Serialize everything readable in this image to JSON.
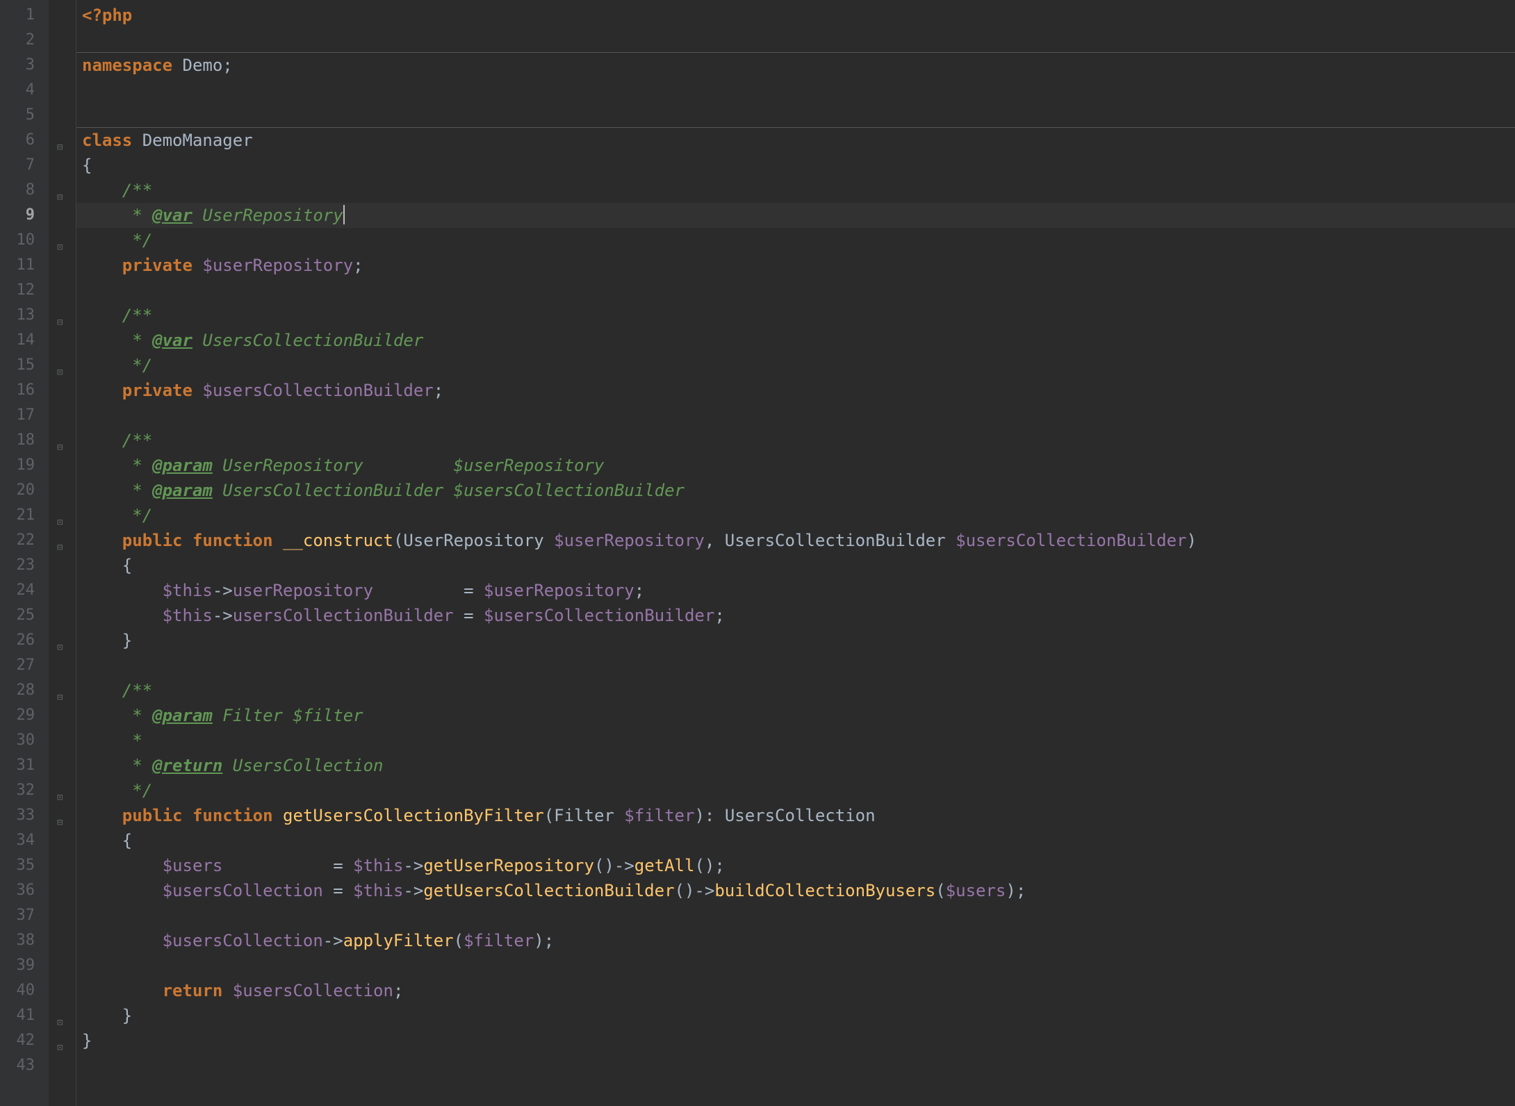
{
  "editor": {
    "current_line": 9,
    "line_numbers": [
      "1",
      "2",
      "3",
      "4",
      "5",
      "6",
      "7",
      "8",
      "9",
      "10",
      "11",
      "12",
      "13",
      "14",
      "15",
      "16",
      "17",
      "18",
      "19",
      "20",
      "21",
      "22",
      "23",
      "24",
      "25",
      "26",
      "27",
      "28",
      "29",
      "30",
      "31",
      "32",
      "33",
      "34",
      "35",
      "36",
      "37",
      "38",
      "39",
      "40",
      "41",
      "42",
      "43"
    ],
    "hr_after_lines": [
      2,
      5
    ],
    "fold_open_lines": [
      6,
      8,
      13,
      18,
      22,
      28,
      33
    ],
    "fold_close_lines": [
      10,
      15,
      21,
      26,
      32,
      41,
      42
    ],
    "tokens": {
      "l1": {
        "php_open": "<?php"
      },
      "l3": {
        "kw": "namespace",
        "name": " Demo",
        "semi": ";"
      },
      "l6": {
        "kw": "class",
        "name": " DemoManager"
      },
      "l7": {
        "brace": "{"
      },
      "l8": {
        "doc": "/**"
      },
      "l9": {
        "star": " * ",
        "tag": "@var",
        "type": " UserRepository"
      },
      "l10": {
        "doc": " */"
      },
      "l11": {
        "kw": "private",
        "var": " $userRepository",
        "semi": ";"
      },
      "l13": {
        "doc": "/**"
      },
      "l14": {
        "star": " * ",
        "tag": "@var",
        "type": " UsersCollectionBuilder"
      },
      "l15": {
        "doc": " */"
      },
      "l16": {
        "kw": "private",
        "var": " $usersCollectionBuilder",
        "semi": ";"
      },
      "l18": {
        "doc": "/**"
      },
      "l19": {
        "star": " * ",
        "tag": "@param",
        "type": " UserRepository         ",
        "pvar": "$userRepository"
      },
      "l20": {
        "star": " * ",
        "tag": "@param",
        "type": " UsersCollectionBuilder ",
        "pvar": "$usersCollectionBuilder"
      },
      "l21": {
        "doc": " */"
      },
      "l22": {
        "kw1": "public",
        "kw2": " function",
        "fn": " __construct",
        "p1": "(",
        "t1": "UserRepository ",
        "v1": "$userRepository",
        "c1": ", ",
        "t2": "UsersCollectionBuilder ",
        "v2": "$usersCollectionBuilder",
        "p2": ")"
      },
      "l23": {
        "brace": "{"
      },
      "l24": {
        "v1": "$this",
        "ar1": "->",
        "f1": "userRepository",
        "pad1": "         ",
        "eq": "= ",
        "v2": "$userRepository",
        "semi": ";"
      },
      "l25": {
        "v1": "$this",
        "ar1": "->",
        "f1": "usersCollectionBuilder",
        "pad1": " ",
        "eq": "= ",
        "v2": "$usersCollectionBuilder",
        "semi": ";"
      },
      "l26": {
        "brace": "}"
      },
      "l28": {
        "doc": "/**"
      },
      "l29": {
        "star": " * ",
        "tag": "@param",
        "type": " Filter ",
        "pvar": "$filter"
      },
      "l30": {
        "doc": " *"
      },
      "l31": {
        "star": " * ",
        "tag": "@return",
        "type": " UsersCollection"
      },
      "l32": {
        "doc": " */"
      },
      "l33": {
        "kw1": "public",
        "kw2": " function",
        "fn": " getUsersCollectionByFilter",
        "p1": "(",
        "t1": "Filter ",
        "v1": "$filter",
        "p2": ")",
        "colon": ": ",
        "rt": "UsersCollection"
      },
      "l34": {
        "brace": "{"
      },
      "l35": {
        "v1": "$users",
        "pad": "           ",
        "eq": "= ",
        "v2": "$this",
        "ar": "->",
        "f1": "getUserRepository",
        "c1": "()->",
        "f2": "getAll",
        "c2": "();"
      },
      "l36": {
        "v1": "$usersCollection",
        "pad": " ",
        "eq": "= ",
        "v2": "$this",
        "ar": "->",
        "f1": "getUsersCollectionBuilder",
        "c1": "()->",
        "f2": "buildCollectionByusers",
        "p1": "(",
        "v3": "$users",
        "p2": ");"
      },
      "l38": {
        "v1": "$usersCollection",
        "ar": "->",
        "f1": "applyFilter",
        "p1": "(",
        "v2": "$filter",
        "p2": ");"
      },
      "l40": {
        "kw": "return ",
        "v1": "$usersCollection",
        "semi": ";"
      },
      "l41": {
        "brace": "}"
      },
      "l42": {
        "brace": "}"
      }
    },
    "indents": {
      "i0": "",
      "i1": "    ",
      "i2": "        ",
      "i3": "            "
    }
  }
}
